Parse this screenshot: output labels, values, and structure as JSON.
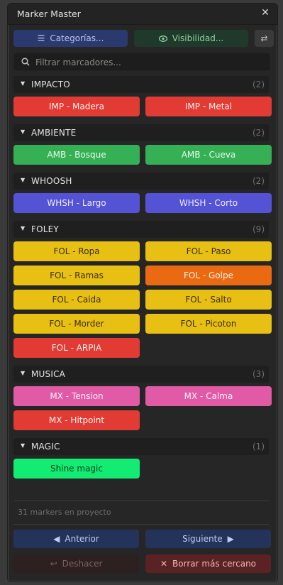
{
  "window": {
    "title": "Marker Master"
  },
  "toolbar": {
    "categories_label": "Categorías...",
    "visibility_label": "Visibilidad...",
    "swap_icon": "swap-arrows-icon"
  },
  "search": {
    "placeholder": "Filtrar marcadores...",
    "value": ""
  },
  "categories": [
    {
      "name": "IMPACTO",
      "count": "(2)",
      "markers": [
        {
          "label": "IMP - Madera",
          "color": "#e23b33"
        },
        {
          "label": "IMP - Metal",
          "color": "#e23b33"
        }
      ]
    },
    {
      "name": "AMBIENTE",
      "count": "(2)",
      "markers": [
        {
          "label": "AMB - Bosque",
          "color": "#35b054"
        },
        {
          "label": "AMB - Cueva",
          "color": "#35b054"
        }
      ]
    },
    {
      "name": "WHOOSH",
      "count": "(2)",
      "markers": [
        {
          "label": "WHSH - Largo",
          "color": "#5453d6"
        },
        {
          "label": "WHSH - Corto",
          "color": "#5453d6"
        }
      ]
    },
    {
      "name": "FOLEY",
      "count": "(9)",
      "markers": [
        {
          "label": "FOL - Ropa",
          "color": "#e8c013"
        },
        {
          "label": "FOL - Paso",
          "color": "#e8c013"
        },
        {
          "label": "FOL - Ramas",
          "color": "#e8c013"
        },
        {
          "label": "FOL - Golpe",
          "color": "#ea6a12"
        },
        {
          "label": "FOL - Caida",
          "color": "#e8c013"
        },
        {
          "label": "FOL - Salto",
          "color": "#e8c013"
        },
        {
          "label": "FOL - Morder",
          "color": "#e8c013"
        },
        {
          "label": "FOL - Picoton",
          "color": "#e8c013"
        },
        {
          "label": "FOL - ARPIA",
          "color": "#e23b33"
        }
      ]
    },
    {
      "name": "MUSICA",
      "count": "(3)",
      "markers": [
        {
          "label": "MX - Tension",
          "color": "#e05aa6"
        },
        {
          "label": "MX - Calma",
          "color": "#e05aa6"
        },
        {
          "label": "MX - Hitpoint",
          "color": "#e23b33"
        }
      ]
    },
    {
      "name": "MAGIC",
      "count": "(1)",
      "markers": [
        {
          "label": "Shine magic",
          "color": "#12ec73"
        }
      ]
    }
  ],
  "footer": {
    "count_text": "31 markers en proyecto",
    "prev_label": "Anterior",
    "next_label": "Siguiente",
    "undo_label": "Deshacer",
    "delete_label": "Borrar más cercano"
  }
}
